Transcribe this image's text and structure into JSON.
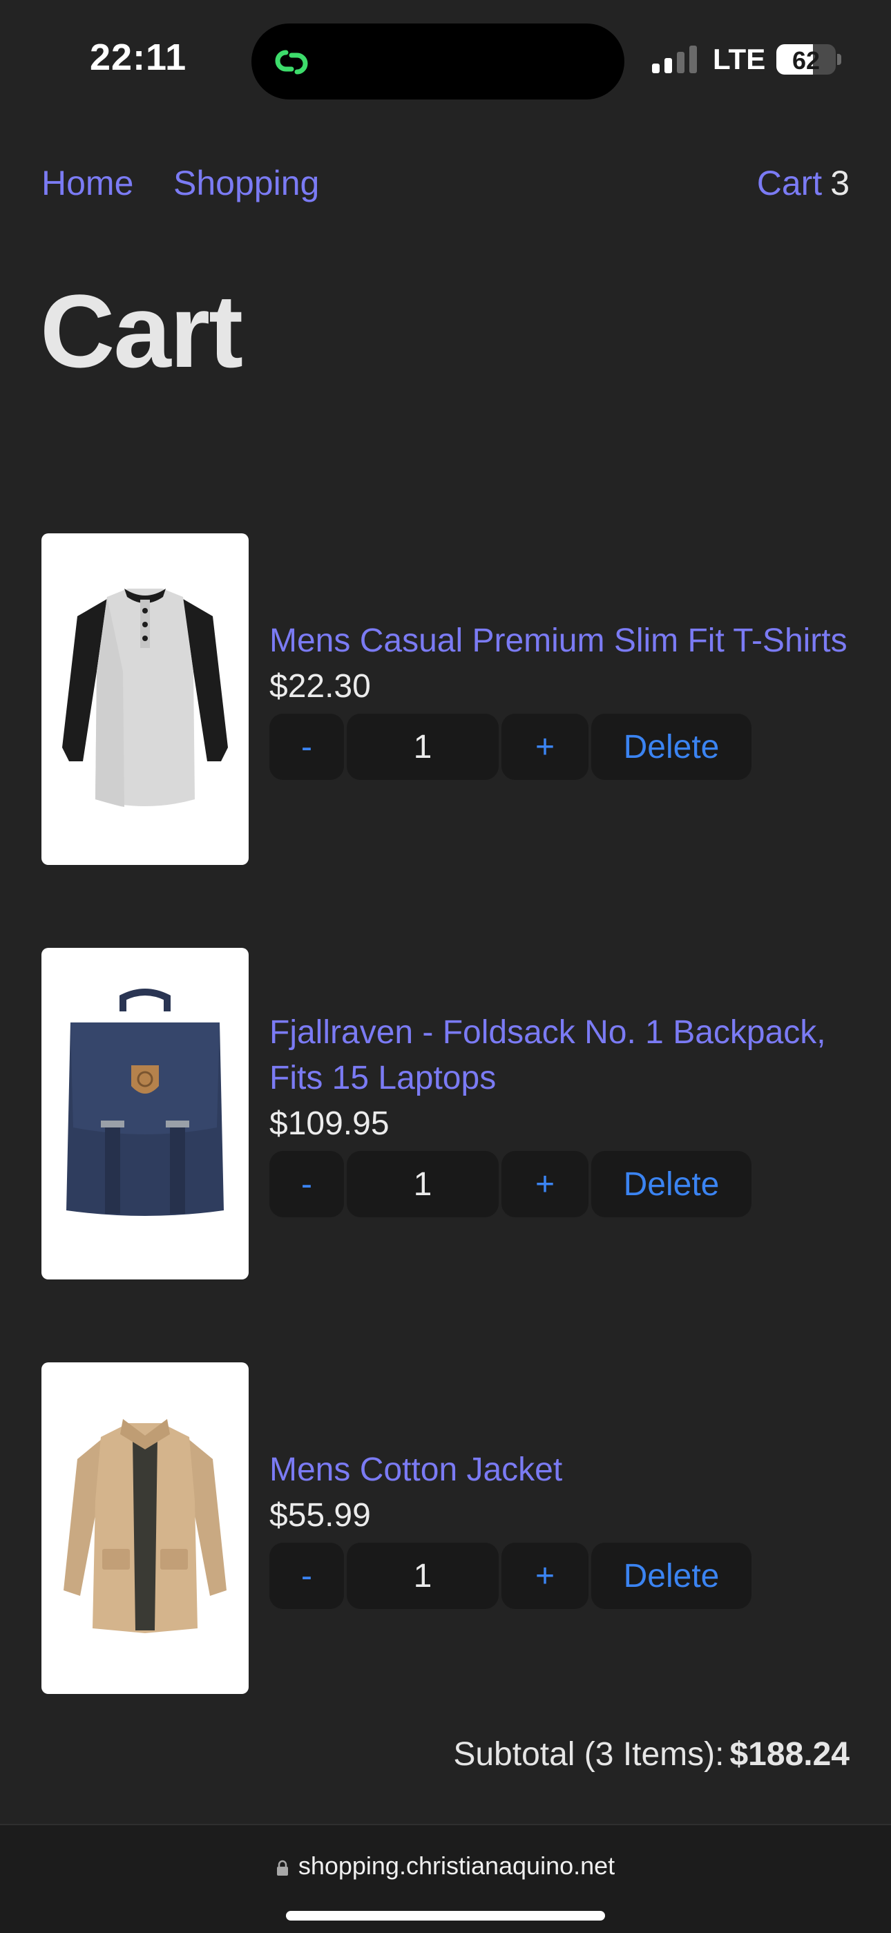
{
  "status_bar": {
    "time": "22:11",
    "network": "LTE",
    "battery_percent": "62",
    "battery_level": 0.62,
    "signal_bars": 2
  },
  "nav": {
    "home": "Home",
    "shopping": "Shopping",
    "cart_label": "Cart",
    "cart_count": "3"
  },
  "page": {
    "title": "Cart"
  },
  "cart": {
    "items": [
      {
        "name": "Mens Casual Premium Slim Fit T-Shirts",
        "price": "$22.30",
        "quantity": "1",
        "image_icon": "tshirt-image"
      },
      {
        "name": "Fjallraven - Foldsack No. 1 Backpack, Fits 15 Laptops",
        "price": "$109.95",
        "quantity": "1",
        "image_icon": "backpack-image"
      },
      {
        "name": "Mens Cotton Jacket",
        "price": "$55.99",
        "quantity": "1",
        "image_icon": "jacket-image"
      }
    ],
    "minus_label": "-",
    "plus_label": "+",
    "delete_label": "Delete",
    "subtotal_label": "Subtotal (3 Items):",
    "subtotal_value": "$188.24"
  },
  "browser": {
    "url": "shopping.christianaquino.net"
  },
  "colors": {
    "background": "#232323",
    "link": "#7b7bf4",
    "button_text": "#3b84f2",
    "button_bg": "#191919"
  }
}
